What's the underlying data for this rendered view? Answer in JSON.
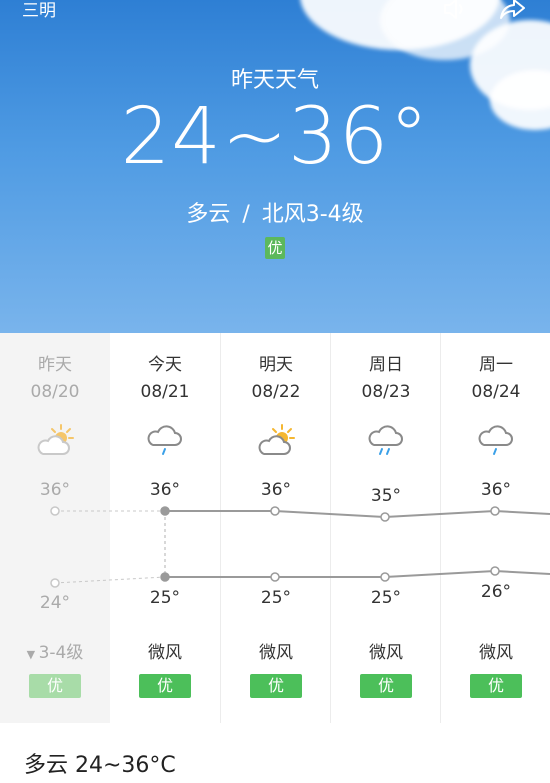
{
  "header": {
    "city": "三明"
  },
  "hero": {
    "caption": "昨天天气",
    "temp_range": "24~36°",
    "condition": "多云",
    "separator": "/",
    "wind": "北风3-4级",
    "aqi": "优"
  },
  "forecast": {
    "days": [
      {
        "name": "昨天",
        "date": "08/20",
        "icon": "partly-cloudy-icon",
        "high": "36°",
        "low": "24°",
        "wind": "3-4级",
        "aqi": "优"
      },
      {
        "name": "今天",
        "date": "08/21",
        "icon": "cloud-rain-icon",
        "high": "36°",
        "low": "25°",
        "wind": "微风",
        "aqi": "优"
      },
      {
        "name": "明天",
        "date": "08/22",
        "icon": "partly-cloudy-icon",
        "high": "36°",
        "low": "25°",
        "wind": "微风",
        "aqi": "优"
      },
      {
        "name": "周日",
        "date": "08/23",
        "icon": "cloud-rain-icon",
        "high": "35°",
        "low": "25°",
        "wind": "微风",
        "aqi": "优"
      },
      {
        "name": "周一",
        "date": "08/24",
        "icon": "cloud-rain-icon",
        "high": "36°",
        "low": "26°",
        "wind": "微风",
        "aqi": "优"
      }
    ],
    "high_values": [
      36,
      36,
      36,
      35,
      36
    ],
    "low_values": [
      24,
      25,
      25,
      25,
      26
    ]
  },
  "footer": {
    "summary": "多云  24~36°C"
  },
  "colors": {
    "sky": "#4f9be3",
    "aqi_good": "#4cbf5a",
    "sun": "#f5b731"
  }
}
